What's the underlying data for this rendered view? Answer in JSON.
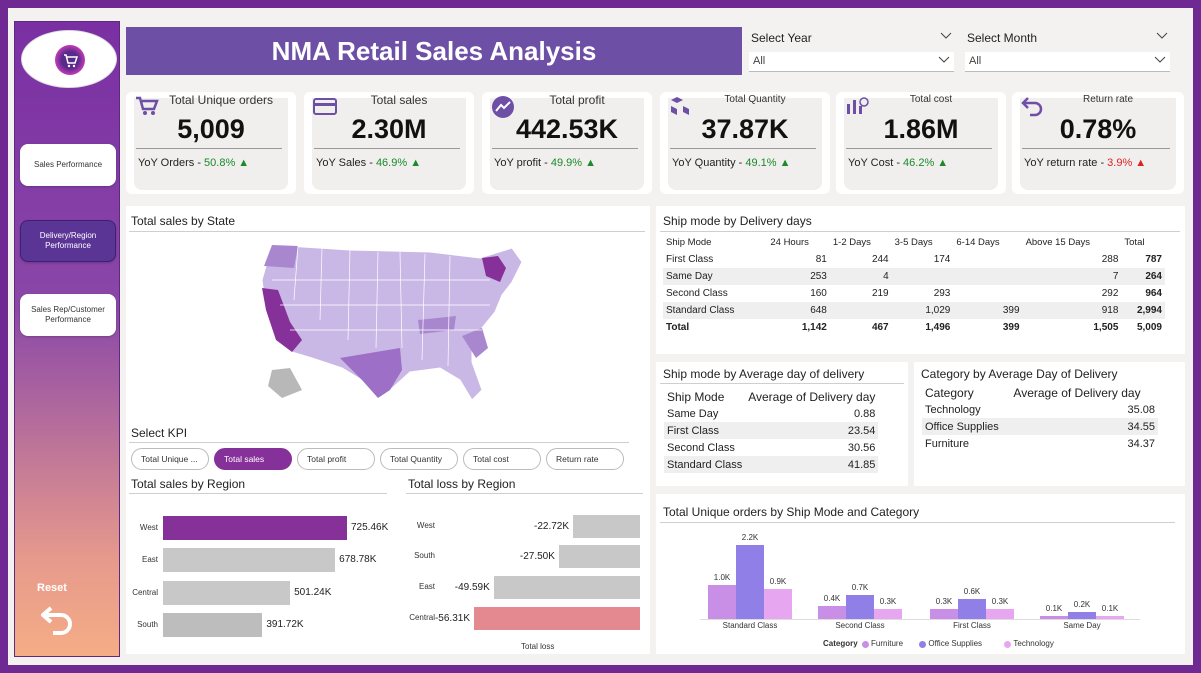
{
  "sidebar": {
    "nav": [
      {
        "label": "Sales Performance",
        "active": false
      },
      {
        "label": "Delivery/Region Performance",
        "active": true
      },
      {
        "label": "Sales Rep/Customer Performance",
        "active": false
      }
    ],
    "reset_label": "Reset"
  },
  "header": {
    "title": "NMA Retail Sales Analysis"
  },
  "slicers": [
    {
      "label": "Select Year",
      "value": "All"
    },
    {
      "label": "Select Month",
      "value": "All"
    }
  ],
  "kpis": [
    {
      "title": "Total Unique orders",
      "value": "5,009",
      "yoy_label": "YoY Orders - ",
      "yoy_value": "50.8%",
      "trend": "up",
      "icon": "cart-icon"
    },
    {
      "title": "Total sales",
      "value": "2.30M",
      "yoy_label": "YoY Sales - ",
      "yoy_value": "46.9%",
      "trend": "up",
      "icon": "card-icon"
    },
    {
      "title": "Total profit",
      "value": "442.53K",
      "yoy_label": "YoY profit - ",
      "yoy_value": "49.9%",
      "trend": "up",
      "icon": "trend-up-icon"
    },
    {
      "title": "Total Quantity",
      "value": "37.87K",
      "yoy_label": "YoY Quantity - ",
      "yoy_value": "49.1%",
      "trend": "up",
      "icon": "boxes-icon"
    },
    {
      "title": "Total cost",
      "value": "1.86M",
      "yoy_label": "YoY Cost - ",
      "yoy_value": "46.2%",
      "trend": "up",
      "icon": "cost-icon"
    },
    {
      "title": "Return rate",
      "value": "0.78%",
      "yoy_label": "YoY return rate - ",
      "yoy_value": "3.9%",
      "trend": "up-bad",
      "icon": "return-icon"
    }
  ],
  "map_panel": {
    "title": "Total sales by State"
  },
  "select_kpi": {
    "label": "Select KPI",
    "options": [
      {
        "label": "Total Unique ...",
        "active": false
      },
      {
        "label": "Total sales",
        "active": true
      },
      {
        "label": "Total profit",
        "active": false
      },
      {
        "label": "Total Quantity",
        "active": false
      },
      {
        "label": "Total cost",
        "active": false
      },
      {
        "label": "Return rate",
        "active": false
      }
    ]
  },
  "ship_delivery_table": {
    "title": "Ship mode by Delivery days",
    "headers": [
      "Ship Mode",
      "24 Hours",
      "1-2 Days",
      "3-5 Days",
      "6-14 Days",
      "Above 15 Days",
      "Total"
    ],
    "rows": [
      [
        "First Class",
        "81",
        "244",
        "174",
        "",
        "288",
        "787"
      ],
      [
        "Same Day",
        "253",
        "4",
        "",
        "",
        "7",
        "264"
      ],
      [
        "Second Class",
        "160",
        "219",
        "293",
        "",
        "292",
        "964"
      ],
      [
        "Standard Class",
        "648",
        "",
        "1,029",
        "399",
        "918",
        "2,994"
      ],
      [
        "Total",
        "1,142",
        "467",
        "1,496",
        "399",
        "1,505",
        "5,009"
      ]
    ]
  },
  "avg_ship_table": {
    "title": "Ship mode by Average day of delivery",
    "headers": [
      "Ship Mode",
      "Average of Delivery day"
    ],
    "rows": [
      [
        "Same Day",
        "0.88"
      ],
      [
        "First Class",
        "23.54"
      ],
      [
        "Second Class",
        "30.56"
      ],
      [
        "Standard Class",
        "41.85"
      ]
    ]
  },
  "avg_cat_table": {
    "title": "Category by Average Day of Delivery",
    "headers": [
      "Category",
      "Average of Delivery day"
    ],
    "rows": [
      [
        "Technology",
        "35.08"
      ],
      [
        "Office Supplies",
        "34.55"
      ],
      [
        "Furniture",
        "34.37"
      ]
    ]
  },
  "colors": {
    "accent": "#86309a",
    "bar_gray": "#c8c8c8",
    "loss_pink": "#e4898f",
    "furniture": "#c98ee6",
    "office_supplies": "#8f7fe6",
    "technology": "#e6a6f0"
  },
  "chart_data": [
    {
      "type": "bar",
      "title": "Total sales by Region",
      "categories": [
        "West",
        "East",
        "Central",
        "South"
      ],
      "values": [
        725.46,
        678.78,
        501.24,
        391.72
      ],
      "labels": [
        "725.46K",
        "678.78K",
        "501.24K",
        "391.72K"
      ],
      "orientation": "horizontal"
    },
    {
      "type": "bar",
      "title": "Total loss by Region",
      "categories": [
        "West",
        "South",
        "East",
        "Central"
      ],
      "values": [
        -22.72,
        -27.5,
        -49.59,
        -56.31
      ],
      "labels": [
        "-22.72K",
        "-27.50K",
        "-49.59K",
        "-56.31K"
      ],
      "xlabel": "Total loss",
      "orientation": "horizontal"
    },
    {
      "type": "bar",
      "title": "Total Unique orders by Ship Mode and Category",
      "categories": [
        "Standard Class",
        "Second Class",
        "First Class",
        "Same Day"
      ],
      "legend_title": "Category",
      "series": [
        {
          "name": "Furniture",
          "values": [
            1.0,
            0.4,
            0.3,
            0.1
          ],
          "labels": [
            "1.0K",
            "0.4K",
            "0.3K",
            "0.1K"
          ]
        },
        {
          "name": "Office Supplies",
          "values": [
            2.2,
            0.7,
            0.6,
            0.2
          ],
          "labels": [
            "2.2K",
            "0.7K",
            "0.6K",
            "0.2K"
          ]
        },
        {
          "name": "Technology",
          "values": [
            0.9,
            0.3,
            0.3,
            0.1
          ],
          "labels": [
            "0.9K",
            "0.3K",
            "0.3K",
            "0.1K"
          ]
        }
      ],
      "legend": "bottom"
    }
  ]
}
